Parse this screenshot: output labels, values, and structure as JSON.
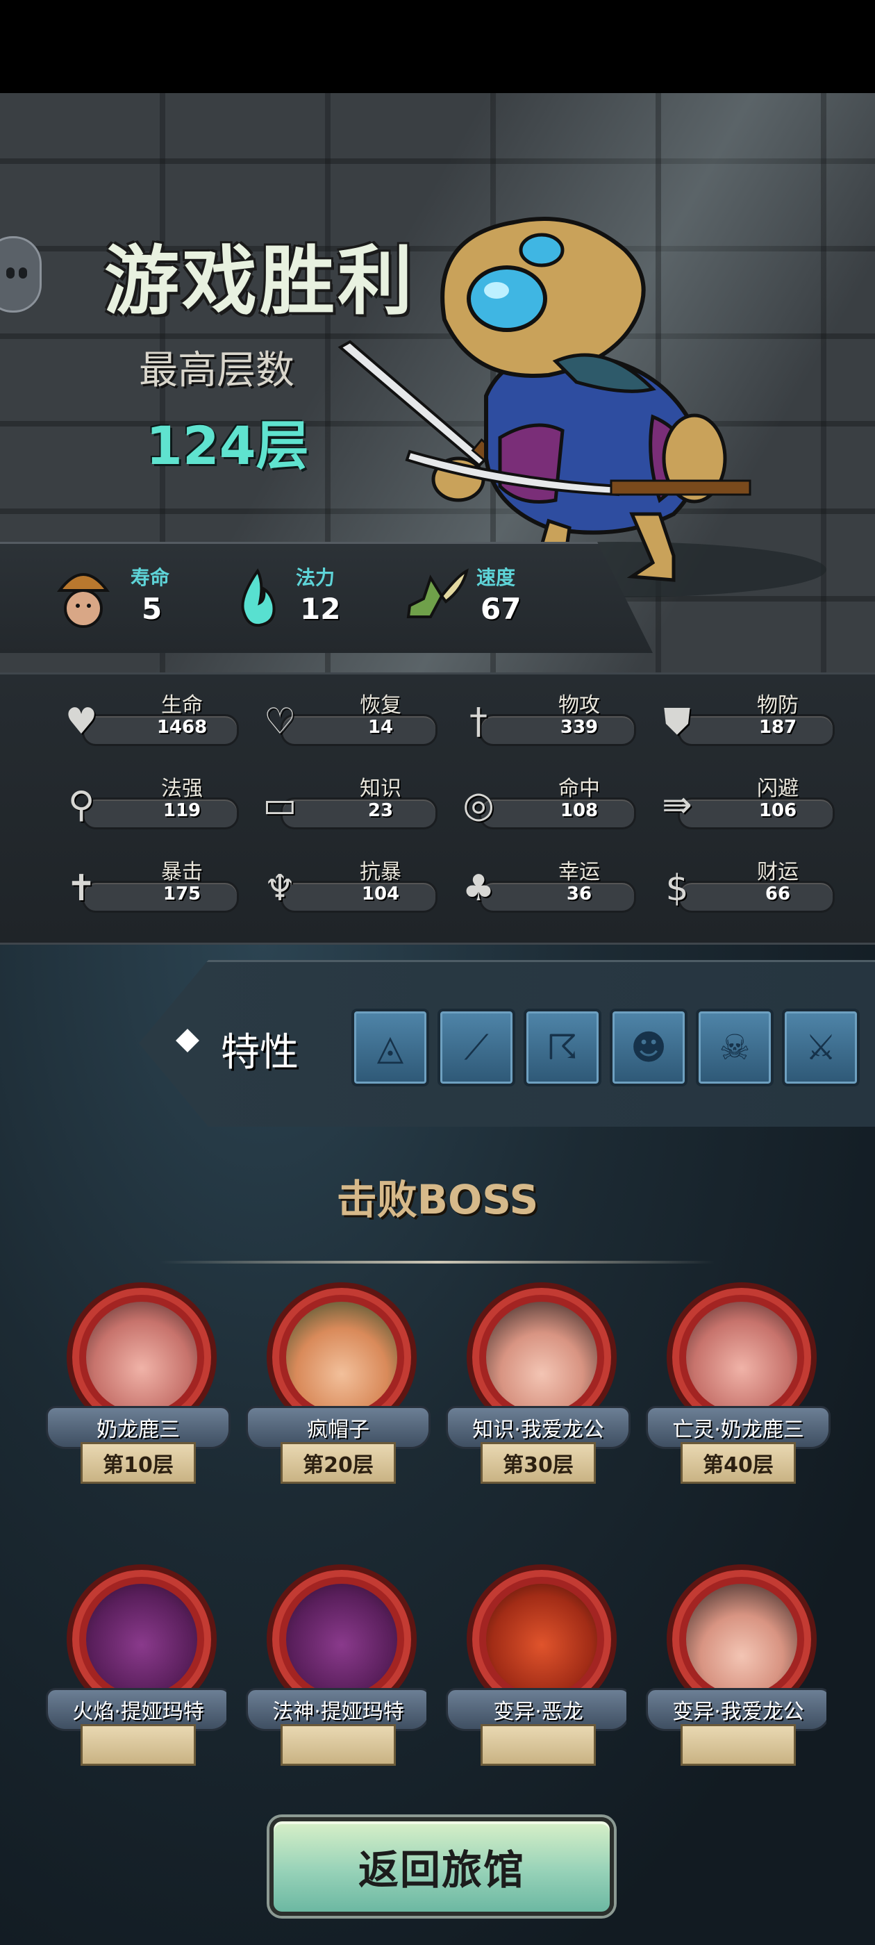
{
  "header": {
    "title": "游戏胜利",
    "max_floor_label": "最高层数",
    "max_floor_value": "124层"
  },
  "basic_stats": [
    {
      "label": "寿命",
      "value": "5",
      "icon": "mushroom-head-icon"
    },
    {
      "label": "法力",
      "value": "12",
      "icon": "flame-icon"
    },
    {
      "label": "速度",
      "value": "67",
      "icon": "winged-boot-icon"
    }
  ],
  "stats": [
    {
      "label": "生命",
      "value": "1468",
      "icon": "heart-icon"
    },
    {
      "label": "恢复",
      "value": "14",
      "icon": "heart-plus-icon"
    },
    {
      "label": "物攻",
      "value": "339",
      "icon": "sword-icon"
    },
    {
      "label": "物防",
      "value": "187",
      "icon": "armor-icon"
    },
    {
      "label": "法强",
      "value": "119",
      "icon": "staff-icon"
    },
    {
      "label": "知识",
      "value": "23",
      "icon": "book-icon"
    },
    {
      "label": "命中",
      "value": "108",
      "icon": "target-icon"
    },
    {
      "label": "闪避",
      "value": "106",
      "icon": "dodge-arrows-icon"
    },
    {
      "label": "暴击",
      "value": "175",
      "icon": "crit-blade-icon"
    },
    {
      "label": "抗暴",
      "value": "104",
      "icon": "shell-shield-icon"
    },
    {
      "label": "幸运",
      "value": "36",
      "icon": "clover-icon"
    },
    {
      "label": "财运",
      "value": "66",
      "icon": "coin-icon"
    }
  ],
  "traits": {
    "label": "特性",
    "slots": [
      "rune-icon",
      "blade-icon",
      "claw-icon",
      "pumpkin-icon",
      "skull-icon",
      "crossed-guns-icon"
    ]
  },
  "bosses": {
    "title": "击败BOSS",
    "items": [
      {
        "name": "奶龙鹿三",
        "floor": "第10层"
      },
      {
        "name": "疯帽子",
        "floor": "第20层"
      },
      {
        "name": "知识·我爱龙公",
        "floor": "第30层"
      },
      {
        "name": "亡灵·奶龙鹿三",
        "floor": "第40层"
      },
      {
        "name": "火焰·提娅玛特",
        "floor": ""
      },
      {
        "name": "法神·提娅玛特",
        "floor": ""
      },
      {
        "name": "变异·恶龙",
        "floor": ""
      },
      {
        "name": "变异·我爱龙公",
        "floor": ""
      }
    ]
  },
  "buttons": {
    "return": "返回旅馆"
  }
}
